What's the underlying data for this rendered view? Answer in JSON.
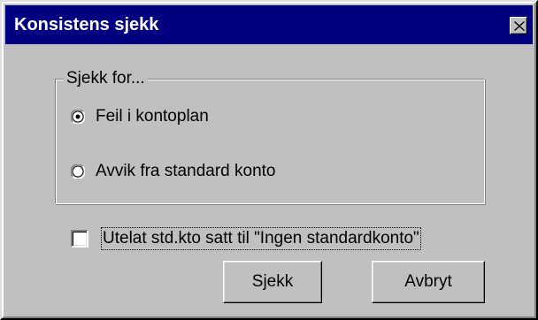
{
  "window": {
    "title": "Konsistens sjekk",
    "close_icon": "close-icon"
  },
  "group": {
    "legend": "Sjekk for...",
    "options": [
      {
        "label": "Feil i kontoplan",
        "selected": true
      },
      {
        "label": "Avvik fra standard konto",
        "selected": false
      }
    ]
  },
  "checkbox": {
    "label": "Utelat std.kto satt til \"Ingen standardkonto\"",
    "checked": false
  },
  "buttons": {
    "ok_label": "Sjekk",
    "cancel_label": "Avbryt"
  },
  "colors": {
    "titlebar": "#000080",
    "face": "#c0c0c0"
  }
}
